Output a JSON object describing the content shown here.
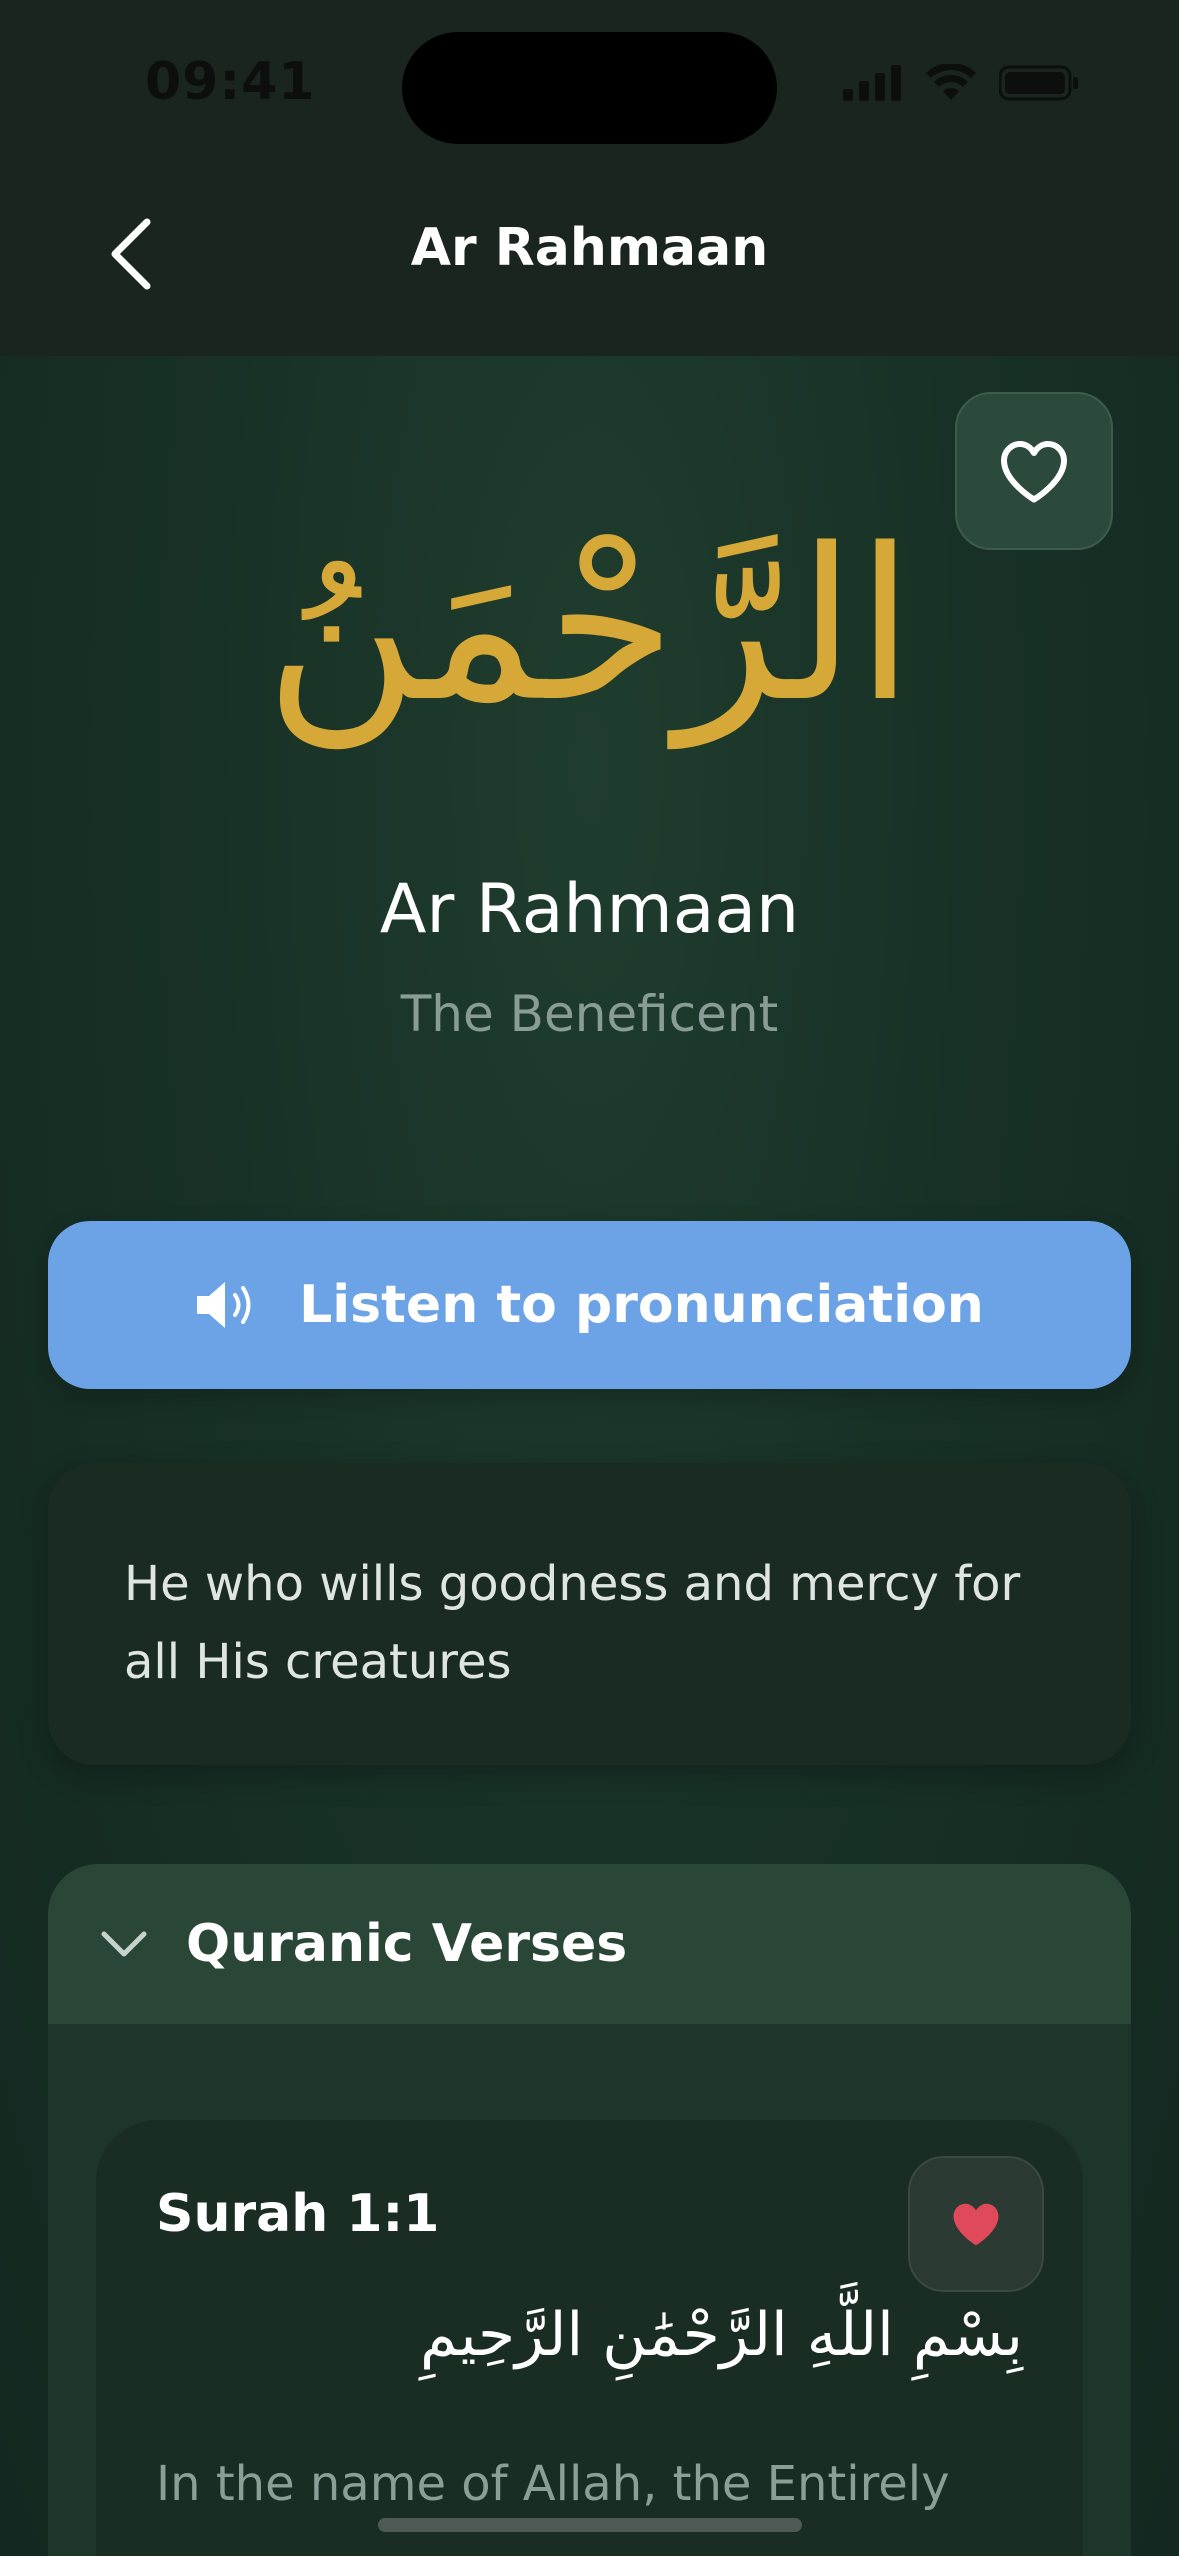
{
  "status_bar": {
    "time": "09:41",
    "icons": [
      "cellular-signal-icon",
      "wifi-icon",
      "battery-icon"
    ]
  },
  "nav": {
    "back_icon": "chevron-left-icon",
    "title": "Ar Rahmaan"
  },
  "name": {
    "arabic": "الرَّحْمَنُ",
    "transliteration": "Ar Rahmaan",
    "meaning": "The Beneficent",
    "favorite_icon": "heart-outline-icon"
  },
  "listen_button": {
    "icon": "speaker-icon",
    "label": "Listen to pronunciation"
  },
  "description": "He who wills goodness and mercy for all His creatures",
  "verses": {
    "header_icon": "chevron-down-icon",
    "title": "Quranic Verses",
    "items": [
      {
        "reference": "Surah 1:1",
        "arabic": "بِسْمِ اللَّهِ الرَّحْمَٰنِ الرَّحِيمِ",
        "translation": "In the name of Allah, the Entirely",
        "favorite_icon": "heart-filled-icon"
      }
    ]
  },
  "colors": {
    "accent_gold": "#d5a838",
    "button_blue": "#6ca3e6",
    "heart_red": "#e0495a"
  }
}
